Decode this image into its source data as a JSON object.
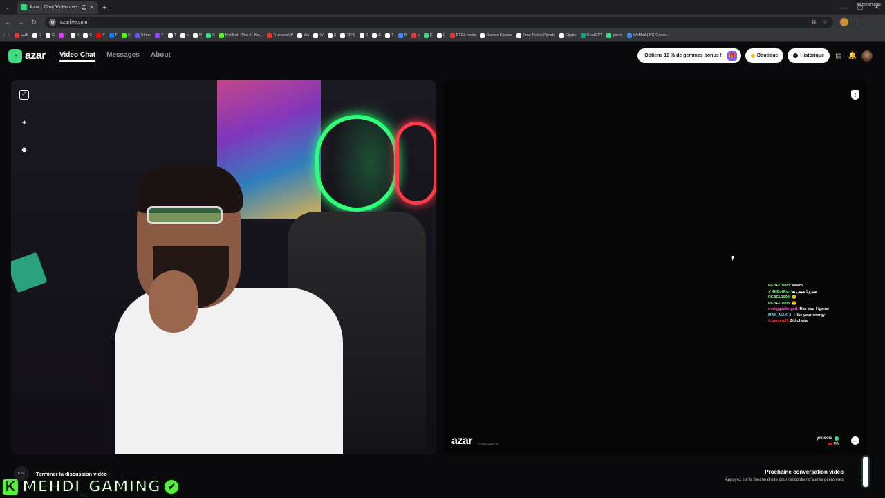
{
  "browser": {
    "tab_title": "Azar : Chat Vidéo avec de",
    "url": "azarlive.com",
    "new_tab_symbol": "+",
    "bookmarks": [
      {
        "label": "اللغة",
        "color": "#e53935"
      },
      {
        "label": "G",
        "color": "#ffffff"
      },
      {
        "label": "G",
        "color": "#ffffff"
      },
      {
        "label": "I",
        "color": "#e040fb"
      },
      {
        "label": "X",
        "color": "#ffffff"
      },
      {
        "label": "X",
        "color": "#ffffff"
      },
      {
        "label": "Y",
        "color": "#ff0000"
      },
      {
        "label": "F",
        "color": "#1877f2"
      },
      {
        "label": "K",
        "color": "#53fc18"
      },
      {
        "label": "Stripe",
        "color": "#635bff"
      },
      {
        "label": "T",
        "color": "#9146ff"
      },
      {
        "label": "T",
        "color": "#ffffff"
      },
      {
        "label": "b",
        "color": "#ffffff"
      },
      {
        "label": "N",
        "color": "#ffffff"
      },
      {
        "label": "S",
        "color": "#3ddc84"
      },
      {
        "label": "KickBot - The #1 Kic...",
        "color": "#53fc18"
      },
      {
        "label": "TruckersMP",
        "color": "#e53935"
      },
      {
        "label": "Wa",
        "color": "#ffffff"
      },
      {
        "label": "W",
        "color": "#ffffff"
      },
      {
        "label": "S",
        "color": "#ffffff"
      },
      {
        "label": "TIPS",
        "color": "#ffffff"
      },
      {
        "label": "S",
        "color": "#ffffff"
      },
      {
        "label": "C",
        "color": "#ffffff"
      },
      {
        "label": "T",
        "color": "#ffffff"
      },
      {
        "label": "R",
        "color": "#4285f4"
      },
      {
        "label": "b",
        "color": "#e53935"
      },
      {
        "label": "C",
        "color": "#3ddc84"
      },
      {
        "label": "C",
        "color": "#ffffff"
      },
      {
        "label": "ETS2 mods",
        "color": "#e53935"
      },
      {
        "label": "Games Sounds",
        "color": "#ffffff"
      },
      {
        "label": "Free Twitch Panels",
        "color": "#ffffff"
      },
      {
        "label": "Elgato",
        "color": "#ffffff"
      },
      {
        "label": "ChatGPT",
        "color": "#10a37f"
      },
      {
        "label": "pixels",
        "color": "#3ddc84"
      },
      {
        "label": "WeMod | PC Game...",
        "color": "#4285f4"
      }
    ],
    "all_bookmarks": "All Bookmarks"
  },
  "header": {
    "logo_text": "azar",
    "nav": [
      {
        "label": "Video Chat",
        "active": true
      },
      {
        "label": "Messages",
        "active": false
      },
      {
        "label": "About",
        "active": false
      }
    ],
    "promo_label": "Obtiens 10 % de gemmes bonus !",
    "shop_label": "Boutique",
    "history_label": "Historique"
  },
  "left_video": {
    "tools": [
      "expand-icon",
      "magic-wand-icon",
      "face-filter-icon"
    ]
  },
  "right_video": {
    "chat": [
      {
        "user": "REBEL1993:",
        "message": "salam",
        "color": "#7dff7a"
      },
      {
        "user": "✔ ❂ BotRix:",
        "message": "سيرونا تعيش بقا",
        "color": "#7dff7a"
      },
      {
        "user": "REBEL1993:",
        "message": "😶",
        "color": "#7dff7a"
      },
      {
        "user": "REBEL1993:",
        "message": "😶",
        "color": "#7dff7a"
      },
      {
        "user": "mohggdzlenged:",
        "message": "Rak star f lgame",
        "color": "#ff5ad2"
      },
      {
        "user": "MAX_MAX_5:",
        "message": "I like your energy",
        "color": "#7fe0ff"
      },
      {
        "user": "0rgaming!!:",
        "message": "Zid chwia",
        "color": "#ff3b4a"
      }
    ],
    "watermark_logo": "azar",
    "watermark_id": "FREE1CBBAT-q",
    "partner_name": "youssra",
    "partner_country": "MA"
  },
  "bottom": {
    "esc_label": "ESC",
    "end_label": "Terminer la discussion vidéo",
    "next_title": "Prochaine conversation vidéo",
    "next_subtitle": "Appuyez sur la touche droite pour rencontrer d'autres personnes"
  },
  "overlay": {
    "badge_letter": "K",
    "name": "MEHDI_GAMING",
    "accent_color": "#55f03a"
  }
}
